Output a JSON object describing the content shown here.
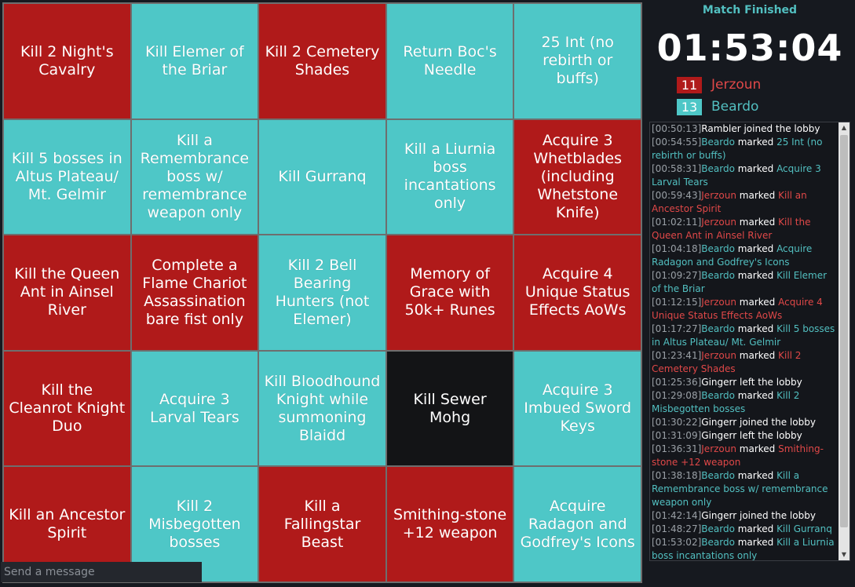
{
  "colors": {
    "red": "#b01a1a",
    "cyan": "#4ec7c7",
    "neutral": "#131416"
  },
  "board": {
    "cells": [
      {
        "text": "Kill 2 Night's Cavalry",
        "color": "red"
      },
      {
        "text": "Kill Elemer of the Briar",
        "color": "cyan"
      },
      {
        "text": "Kill 2 Cemetery Shades",
        "color": "red"
      },
      {
        "text": "Return Boc's Needle",
        "color": "cyan"
      },
      {
        "text": "25 Int (no rebirth or buffs)",
        "color": "cyan"
      },
      {
        "text": "Kill 5 bosses in Altus Plateau/ Mt. Gelmir",
        "color": "cyan"
      },
      {
        "text": "Kill a Remembrance boss w/ remembrance weapon only",
        "color": "cyan"
      },
      {
        "text": "Kill Gurranq",
        "color": "cyan"
      },
      {
        "text": "Kill a Liurnia boss incantations only",
        "color": "cyan"
      },
      {
        "text": "Acquire 3 Whetblades (including Whetstone Knife)",
        "color": "red"
      },
      {
        "text": "Kill the Queen Ant in Ainsel River",
        "color": "red"
      },
      {
        "text": "Complete a Flame Chariot Assassination bare fist only",
        "color": "red"
      },
      {
        "text": "Kill 2 Bell Bearing Hunters (not Elemer)",
        "color": "cyan"
      },
      {
        "text": "Memory of Grace with 50k+ Runes",
        "color": "red"
      },
      {
        "text": "Acquire 4 Unique Status Effects AoWs",
        "color": "red"
      },
      {
        "text": "Kill the Cleanrot Knight Duo",
        "color": "red"
      },
      {
        "text": "Acquire 3 Larval Tears",
        "color": "cyan"
      },
      {
        "text": "Kill Bloodhound Knight while summoning Blaidd",
        "color": "cyan"
      },
      {
        "text": "Kill Sewer Mohg",
        "color": "black"
      },
      {
        "text": "Acquire 3 Imbued Sword Keys",
        "color": "cyan"
      },
      {
        "text": "Kill an Ancestor Spirit",
        "color": "red"
      },
      {
        "text": "Kill 2 Misbegotten bosses",
        "color": "cyan"
      },
      {
        "text": "Kill a Fallingstar Beast",
        "color": "red"
      },
      {
        "text": "Smithing-stone +12 weapon",
        "color": "red"
      },
      {
        "text": "Acquire Radagon and Godfrey's Icons",
        "color": "cyan"
      }
    ]
  },
  "status": "Match Finished",
  "timer": "01:53:04",
  "scores": [
    {
      "score": "11",
      "name": "Jerzoun",
      "color": "#b01a1a",
      "name_color": "#e04848"
    },
    {
      "score": "13",
      "name": "Beardo",
      "color": "#4ec7c7",
      "name_color": "#52bfc0"
    }
  ],
  "chat": [
    {
      "time": "[00:50:13]",
      "name": "Rambler",
      "nc": "plain",
      "action": " joined the lobby",
      "target": "",
      "tc": "plain"
    },
    {
      "time": "[00:54:55]",
      "name": "Beardo",
      "nc": "cyan",
      "action": " marked ",
      "target": "25 Int (no rebirth or buffs)",
      "tc": "cyan"
    },
    {
      "time": "[00:58:31]",
      "name": "Beardo",
      "nc": "cyan",
      "action": " marked ",
      "target": "Acquire 3 Larval Tears",
      "tc": "cyan"
    },
    {
      "time": "[00:59:43]",
      "name": "Jerzoun",
      "nc": "red",
      "action": " marked ",
      "target": "Kill an Ancestor Spirit",
      "tc": "red"
    },
    {
      "time": "[01:02:11]",
      "name": "Jerzoun",
      "nc": "red",
      "action": " marked ",
      "target": "Kill the Queen Ant in Ainsel River",
      "tc": "red"
    },
    {
      "time": "[01:04:18]",
      "name": "Beardo",
      "nc": "cyan",
      "action": " marked ",
      "target": "Acquire Radagon and Godfrey's Icons",
      "tc": "cyan"
    },
    {
      "time": "[01:09:27]",
      "name": "Beardo",
      "nc": "cyan",
      "action": " marked ",
      "target": "Kill Elemer of the Briar",
      "tc": "cyan"
    },
    {
      "time": "[01:12:15]",
      "name": "Jerzoun",
      "nc": "red",
      "action": " marked ",
      "target": "Acquire 4 Unique Status Effects AoWs",
      "tc": "red"
    },
    {
      "time": "[01:17:27]",
      "name": "Beardo",
      "nc": "cyan",
      "action": " marked ",
      "target": "Kill 5 bosses in Altus Plateau/ Mt. Gelmir",
      "tc": "cyan"
    },
    {
      "time": "[01:23:41]",
      "name": "Jerzoun",
      "nc": "red",
      "action": " marked ",
      "target": "Kill 2 Cemetery Shades",
      "tc": "red"
    },
    {
      "time": "[01:25:36]",
      "name": "Gingerr",
      "nc": "plain",
      "action": " left the lobby",
      "target": "",
      "tc": "plain"
    },
    {
      "time": "[01:29:08]",
      "name": "Beardo",
      "nc": "cyan",
      "action": " marked ",
      "target": "Kill 2 Misbegotten bosses",
      "tc": "cyan"
    },
    {
      "time": "[01:30:22]",
      "name": "Gingerr",
      "nc": "plain",
      "action": " joined the lobby",
      "target": "",
      "tc": "plain"
    },
    {
      "time": "[01:31:09]",
      "name": "Gingerr",
      "nc": "plain",
      "action": " left the lobby",
      "target": "",
      "tc": "plain"
    },
    {
      "time": "[01:36:31]",
      "name": "Jerzoun",
      "nc": "red",
      "action": " marked ",
      "target": "Smithing-stone +12 weapon",
      "tc": "red"
    },
    {
      "time": "[01:38:18]",
      "name": "Beardo",
      "nc": "cyan",
      "action": " marked ",
      "target": "Kill a Remembrance boss w/ remembrance weapon only",
      "tc": "cyan"
    },
    {
      "time": "[01:42:14]",
      "name": "Gingerr",
      "nc": "plain",
      "action": " joined the lobby",
      "target": "",
      "tc": "plain"
    },
    {
      "time": "[01:48:27]",
      "name": "Beardo",
      "nc": "cyan",
      "action": " marked ",
      "target": "Kill Gurranq",
      "tc": "cyan"
    },
    {
      "time": "[01:53:02]",
      "name": "Beardo",
      "nc": "cyan",
      "action": " marked ",
      "target": "Kill a Liurnia boss incantations only",
      "tc": "cyan"
    }
  ],
  "input": {
    "placeholder": "Send a message"
  },
  "scroll_icons": {
    "up": "triangle-up-icon",
    "down": "triangle-down-icon"
  }
}
